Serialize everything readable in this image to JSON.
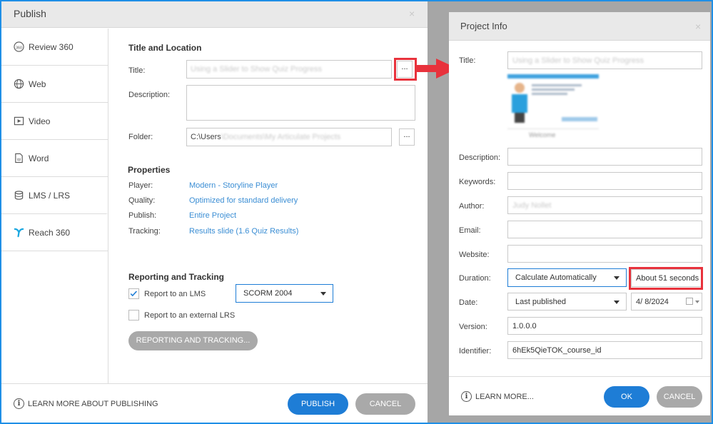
{
  "publish": {
    "title": "Publish",
    "close": "×",
    "sidebar": [
      {
        "label": "Review 360",
        "icon": "review360-icon"
      },
      {
        "label": "Web",
        "icon": "globe-icon"
      },
      {
        "label": "Video",
        "icon": "video-icon"
      },
      {
        "label": "Word",
        "icon": "word-icon"
      },
      {
        "label": "LMS / LRS",
        "icon": "lms-icon"
      },
      {
        "label": "Reach 360",
        "icon": "reach360-icon"
      }
    ],
    "title_location": {
      "heading": "Title and Location",
      "title_label": "Title:",
      "title_value": "Using a Slider to Show Quiz Progress",
      "description_label": "Description:",
      "folder_label": "Folder:",
      "folder_value": "C:\\Users",
      "folder_blurred": "\\Documents\\My Articulate Projects",
      "browse": "..."
    },
    "properties": {
      "heading": "Properties",
      "player_label": "Player:",
      "player_value": "Modern - Storyline Player",
      "quality_label": "Quality:",
      "quality_value": "Optimized for standard delivery",
      "publish_label": "Publish:",
      "publish_value": "Entire Project",
      "tracking_label": "Tracking:",
      "tracking_value": "Results slide (1.6 Quiz Results)"
    },
    "reporting": {
      "heading": "Reporting and Tracking",
      "report_lms": "Report to an LMS",
      "report_lms_checked": true,
      "lms_standard": "SCORM 2004",
      "report_lrs": "Report to an external LRS",
      "report_lrs_checked": false,
      "button": "REPORTING AND TRACKING..."
    },
    "footer": {
      "learn_more": "LEARN MORE ABOUT PUBLISHING",
      "publish": "PUBLISH",
      "cancel": "CANCEL"
    }
  },
  "project_info": {
    "title": "Project Info",
    "close": "×",
    "title_label": "Title:",
    "title_value": "Using a Slider to Show Quiz Progress",
    "thumb_caption": "Welcome",
    "description_label": "Description:",
    "keywords_label": "Keywords:",
    "author_label": "Author:",
    "author_value": "Judy Nollet",
    "email_label": "Email:",
    "website_label": "Website:",
    "duration_label": "Duration:",
    "duration_mode": "Calculate Automatically",
    "duration_value": "About 51 seconds",
    "date_label": "Date:",
    "date_mode": "Last published",
    "date_value": "4/  8/2024",
    "version_label": "Version:",
    "version_value": "1.0.0.0",
    "identifier_label": "Identifier:",
    "identifier_value": "6hEk5QieTOK_course_id",
    "footer": {
      "learn_more": "LEARN MORE...",
      "ok": "OK",
      "cancel": "CANCEL"
    }
  },
  "colors": {
    "accent": "#1e7dd6",
    "link": "#3b8ed4",
    "highlight": "#e8323c",
    "frame": "#1f8fe6"
  }
}
